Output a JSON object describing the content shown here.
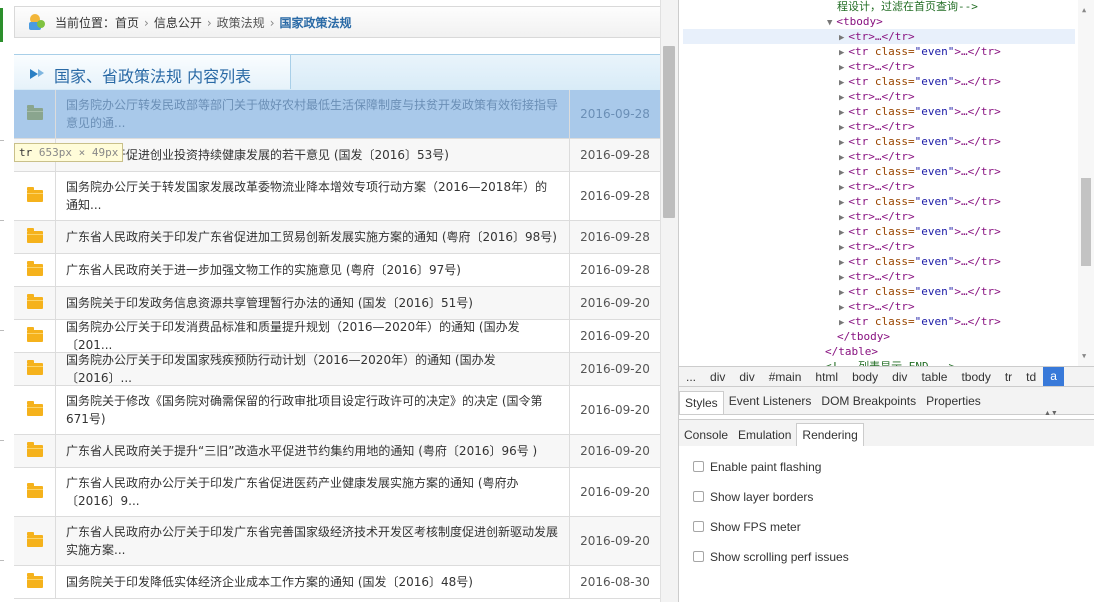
{
  "breadcrumb": {
    "prefix": "当前位置：",
    "items": [
      "首页",
      "信息公开",
      "政策法规"
    ],
    "current": "国家政策法规",
    "separator": "›"
  },
  "panel": {
    "title": "国家、省政策法规 内容列表"
  },
  "tooltip": {
    "tag": "tr",
    "size": "653px × 49px"
  },
  "rows": [
    {
      "title": "国务院办公厅转发民政部等部门关于做好农村最低生活保障制度与扶贫开发政策有效衔接指导意见的通...",
      "date": "2016-09-28"
    },
    {
      "title": "国务院关于促进创业投资持续健康发展的若干意见 (国发〔2016〕53号)",
      "date": "2016-09-28"
    },
    {
      "title": "国务院办公厅关于转发国家发展改革委物流业降本增效专项行动方案（2016—2018年）的通知...",
      "date": "2016-09-28"
    },
    {
      "title": "广东省人民政府关于印发广东省促进加工贸易创新发展实施方案的通知 (粤府〔2016〕98号)",
      "date": "2016-09-28"
    },
    {
      "title": "广东省人民政府关于进一步加强文物工作的实施意见 (粤府〔2016〕97号)",
      "date": "2016-09-28"
    },
    {
      "title": "国务院关于印发政务信息资源共享管理暂行办法的通知 (国发〔2016〕51号)",
      "date": "2016-09-20"
    },
    {
      "title": "国务院办公厅关于印发消费品标准和质量提升规划（2016—2020年）的通知 (国办发〔201...",
      "date": "2016-09-20"
    },
    {
      "title": "国务院办公厅关于印发国家残疾预防行动计划（2016—2020年）的通知 (国办发〔2016〕...",
      "date": "2016-09-20"
    },
    {
      "title": "国务院关于修改《国务院对确需保留的行政审批项目设定行政许可的决定》的决定 (国令第671号)",
      "date": "2016-09-20"
    },
    {
      "title": "广东省人民政府关于提升“三旧”改造水平促进节约集约用地的通知 (粤府〔2016〕96号 )",
      "date": "2016-09-20"
    },
    {
      "title": "广东省人民政府办公厅关于印发广东省促进医药产业健康发展实施方案的通知 (粤府办〔2016〕9...",
      "date": "2016-09-20"
    },
    {
      "title": "广东省人民政府办公厅关于印发广东省完善国家级经济技术开发区考核制度促进创新驱动发展实施方案...",
      "date": "2016-09-20"
    },
    {
      "title": "国务院关于印发降低实体经济企业成本工作方案的通知 (国发〔2016〕48号)",
      "date": "2016-08-30"
    }
  ],
  "devtools": {
    "comment_line": "程设计，过滤在首页查询-->",
    "tbody_open": "<tbody>",
    "tr_plain": "<tr>…</tr>",
    "tr_even_open": "<tr ",
    "tr_even_attr": "class=",
    "tr_even_val": "\"even\"",
    "tr_even_close": ">…</tr>",
    "tbody_close": "</tbody>",
    "table_close": "</table>",
    "tail_comment": "<!-- 列表显示 END -->",
    "breadcrumb": [
      "...",
      "div",
      "div",
      "#main",
      "html",
      "body",
      "div",
      "table",
      "tbody",
      "tr",
      "td",
      "a"
    ],
    "sub_tabs": [
      "Styles",
      "Event Listeners",
      "DOM Breakpoints",
      "Properties"
    ],
    "drawer_tabs": [
      "Console",
      "Emulation",
      "Rendering"
    ],
    "rendering_options": [
      "Enable paint flashing",
      "Show layer borders",
      "Show FPS meter",
      "Show scrolling perf issues"
    ]
  }
}
